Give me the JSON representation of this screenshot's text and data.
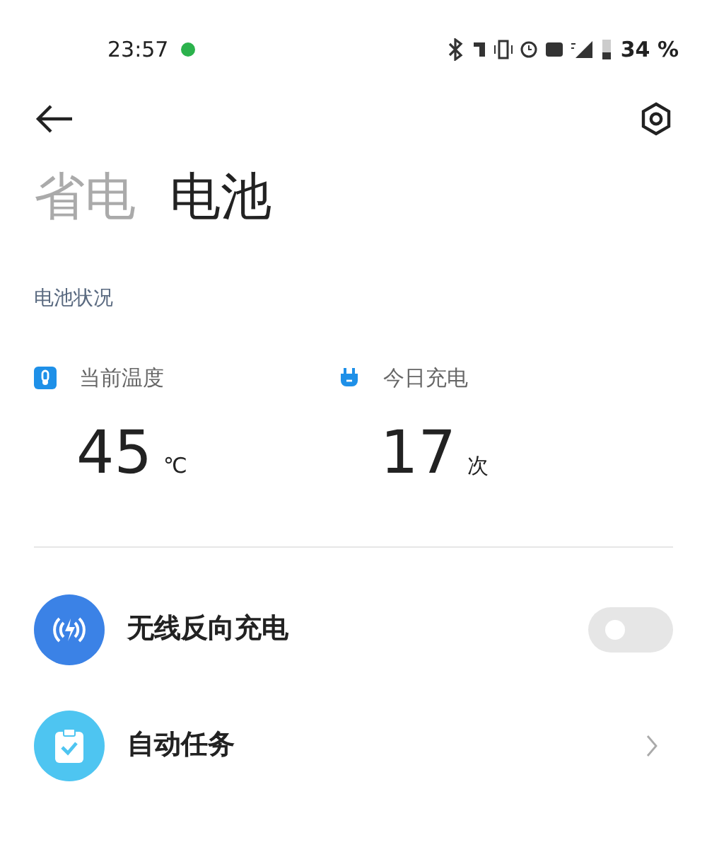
{
  "status_bar": {
    "time": "23:57",
    "battery": "34 %"
  },
  "tabs": [
    {
      "label": "省电",
      "selected": false
    },
    {
      "label": "电池",
      "selected": true
    }
  ],
  "section_title": "电池状况",
  "stats": [
    {
      "kind": "temperature",
      "label": "当前温度",
      "value": "45",
      "unit": "℃"
    },
    {
      "kind": "charges",
      "label": "今日充电",
      "value": "17",
      "unit": "次"
    }
  ],
  "settings": [
    {
      "kind": "toggle",
      "label": "无线反向充电",
      "on": false
    },
    {
      "kind": "link",
      "label": "自动任务"
    }
  ]
}
